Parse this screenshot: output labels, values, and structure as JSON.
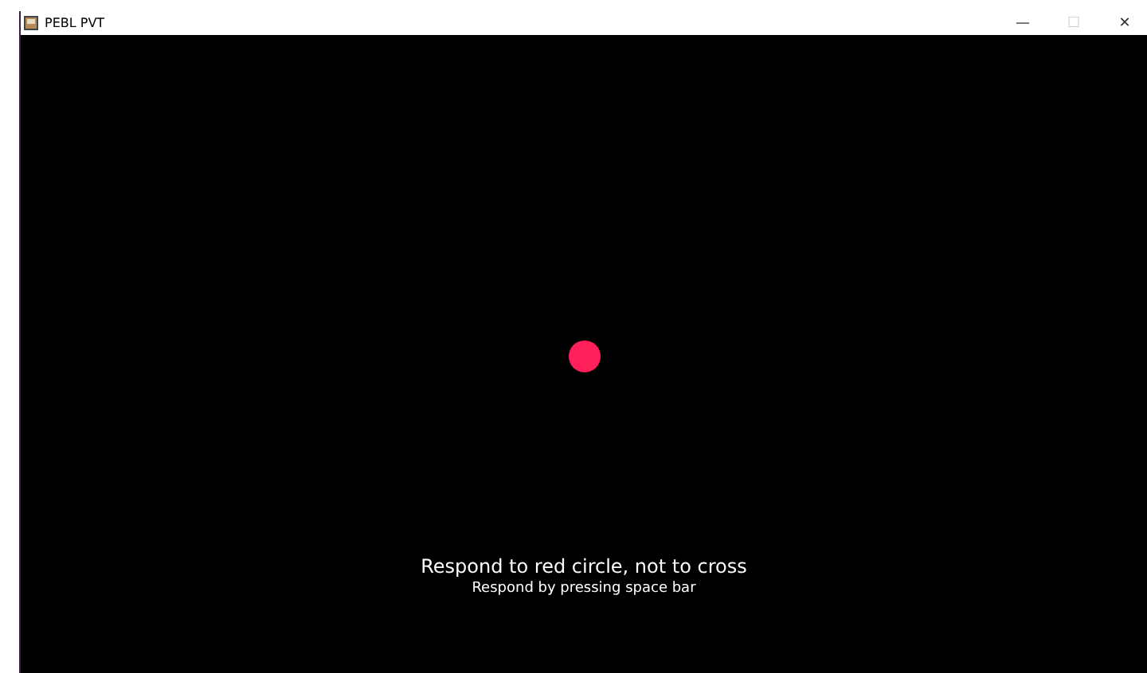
{
  "window": {
    "title": "PEBL PVT",
    "controls": [
      {
        "glyph": "—",
        "disabled": false
      },
      {
        "glyph": "☐",
        "disabled": true
      },
      {
        "glyph": "✕",
        "disabled": false
      }
    ]
  },
  "instructions": [
    "Respond to red circle, not to cross",
    "Respond by pressing space bar"
  ]
}
